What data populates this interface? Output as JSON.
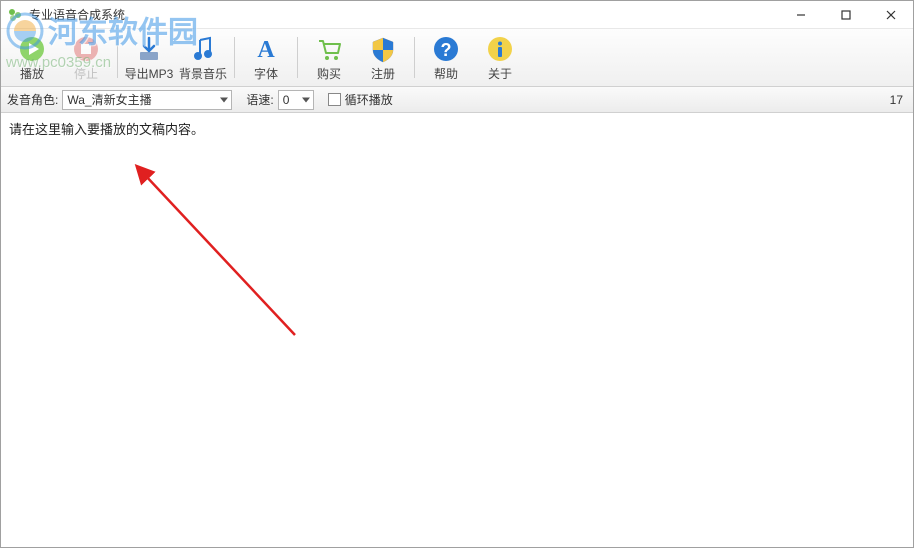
{
  "window": {
    "title": "专业语音合成系统"
  },
  "toolbar": {
    "play": "播放",
    "stop": "停止",
    "export_mp3": "导出MP3",
    "bgm": "背景音乐",
    "font": "字体",
    "buy": "购买",
    "register": "注册",
    "help": "帮助",
    "about": "关于"
  },
  "options": {
    "voice_label": "发音角色:",
    "voice_value": "Wa_清新女主播",
    "speed_label": "语速:",
    "speed_value": "0",
    "loop_label": "循环播放",
    "char_count": "17"
  },
  "editor": {
    "content": "请在这里输入要播放的文稿内容。"
  },
  "watermark": {
    "text": "河东软件园",
    "url": "www.pc0359.cn"
  }
}
